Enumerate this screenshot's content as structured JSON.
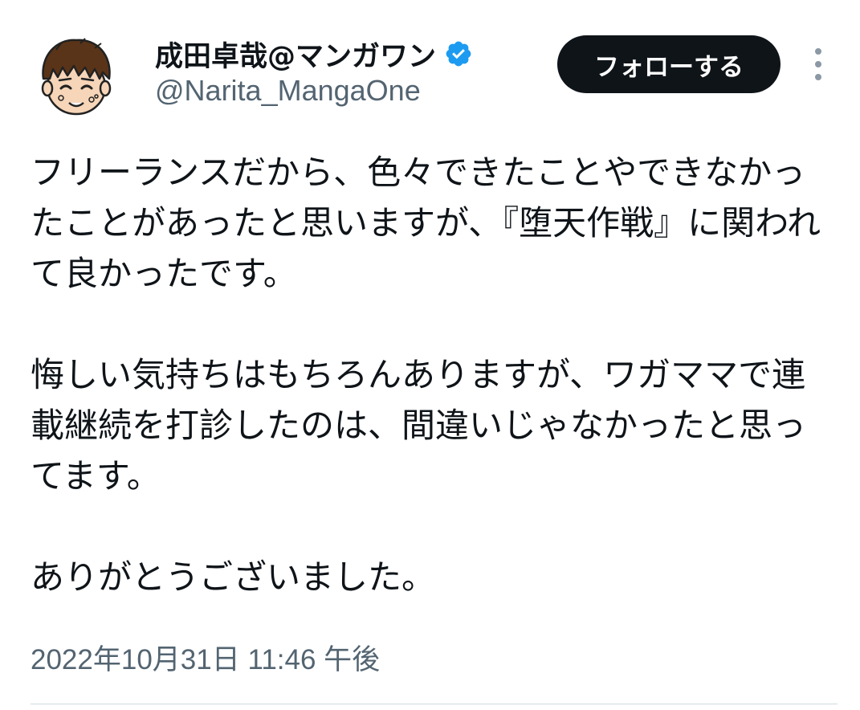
{
  "author": {
    "display_name": "成田卓哉@マンガワン",
    "handle": "@Narita_MangaOne",
    "verified_icon": "verified-badge-icon",
    "avatar_icon": "cartoon-face-avatar"
  },
  "actions": {
    "follow_label": "フォローする",
    "more_icon": "more-vertical-icon"
  },
  "tweet": {
    "paragraphs": [
      "フリーランスだから、色々できたことやできなかったことがあったと思いますが、『堕天作戦』に関われて良かったです。",
      "悔しい気持ちはもちろんありますが、ワガママで連載継続を打診したのは、間違いじゃなかったと思ってます。",
      "ありがとうございました。"
    ],
    "timestamp": "2022年10月31日 11:46 午後"
  },
  "colors": {
    "text_primary": "#0f1419",
    "text_secondary": "#536471",
    "verified_blue": "#1d9bf0",
    "button_bg": "#0f1419",
    "divider": "#cfd9de"
  }
}
